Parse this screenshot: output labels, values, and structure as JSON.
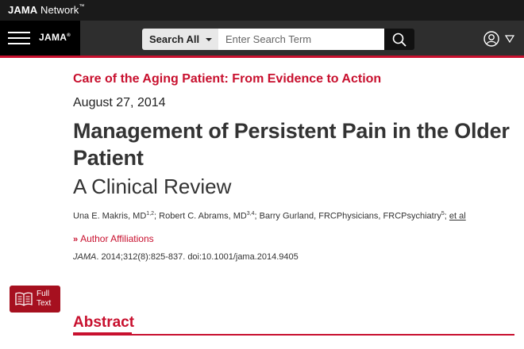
{
  "topbar": {
    "brand_bold": "JAMA",
    "brand_rest": " Network",
    "trademark": "™"
  },
  "navbar": {
    "logo": "JAMA",
    "logo_mark": "®",
    "search_scope": "Search All",
    "search_placeholder": "Enter Search Term",
    "icons": [
      "menu-icon",
      "search-icon",
      "user-icon",
      "chevron-down-icon"
    ]
  },
  "article": {
    "series": "Care of the Aging Patient: From Evidence to Action",
    "date": "August 27, 2014",
    "title": "Management of Persistent Pain in the Older Patient",
    "subtitle": "A Clinical Review",
    "authors": [
      {
        "name": "Una E. Makris, MD",
        "sup": "1,2"
      },
      {
        "name": "Robert C. Abrams, MD",
        "sup": "3,4"
      },
      {
        "name": "Barry Gurland, FRCPhysicians, FRCPsychiatry",
        "sup": "5"
      }
    ],
    "et_al": "et al",
    "affiliations_label": "Author Affiliations",
    "journal": "JAMA",
    "citation_rest": ". 2014;312(8):825-837. doi:10.1001/jama.2014.9405"
  },
  "sidebar": {
    "full_text_line1": "Full",
    "full_text_line2": "Text"
  },
  "sections": {
    "abstract": "Abstract"
  },
  "colors": {
    "accent": "#c8102e",
    "topbar": "#1a1a1a",
    "navbar": "#2e2e2e"
  }
}
